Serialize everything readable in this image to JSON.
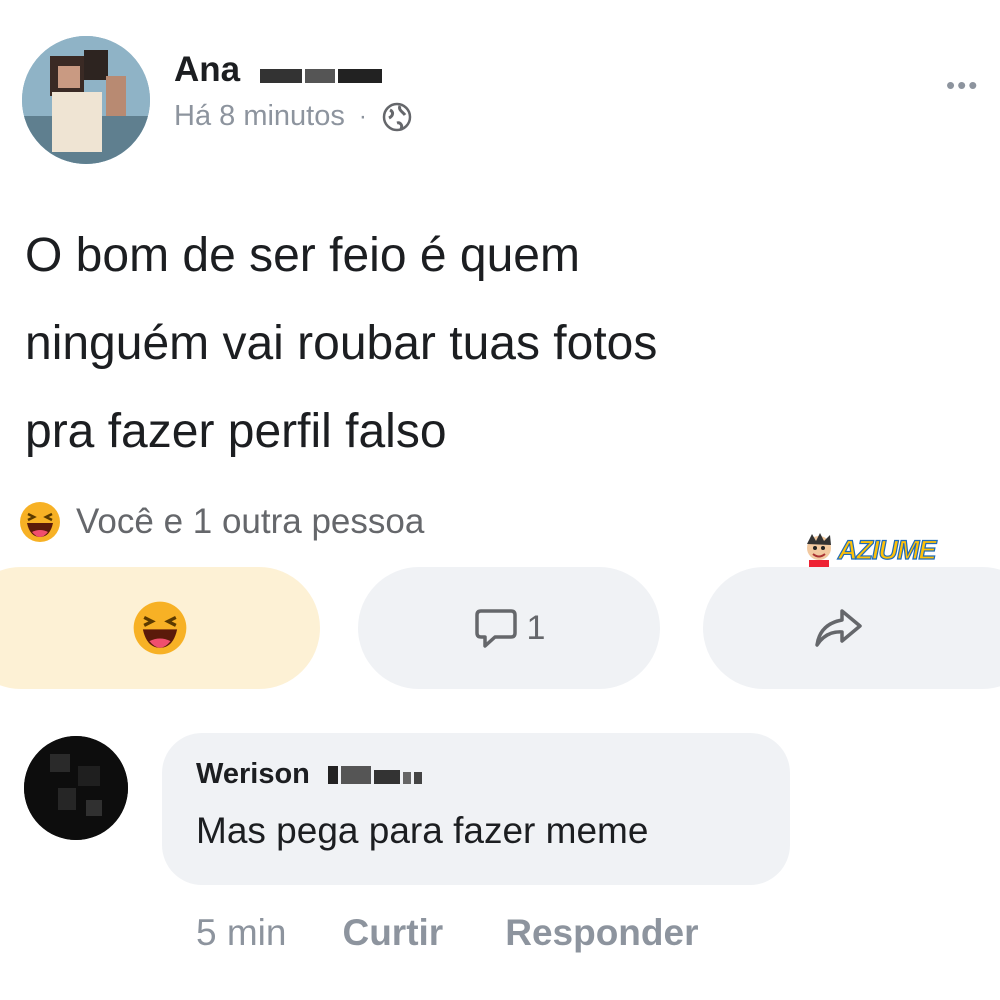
{
  "post": {
    "author_name": "Ana",
    "timestamp": "Há 8 minutos",
    "separator": "·",
    "privacy_icon": "globe-icon",
    "more_icon": "more-options-icon",
    "more_label": "•••",
    "text_lines": [
      "O bom de ser feio é quem",
      "ninguém vai roubar tuas fotos",
      "pra fazer perfil falso"
    ]
  },
  "reactions": {
    "emoji_icon": "laughing-emoji-icon",
    "summary": "Você e 1 outra pessoa"
  },
  "watermark": {
    "text": "AZIUME"
  },
  "actions": {
    "react_icon": "laughing-emoji-icon",
    "comment_icon": "comment-bubble-icon",
    "comment_count": "1",
    "share_icon": "share-arrow-icon"
  },
  "comment": {
    "author_name": "Werison",
    "text": "Mas pega para fazer meme",
    "time": "5 min",
    "like_label": "Curtir",
    "reply_label": "Responder"
  },
  "colors": {
    "laugh_button_bg": "#fdf1d5",
    "button_bg": "#f0f2f5",
    "secondary_text": "#65676b",
    "emoji_yellow": "#f7b125"
  }
}
